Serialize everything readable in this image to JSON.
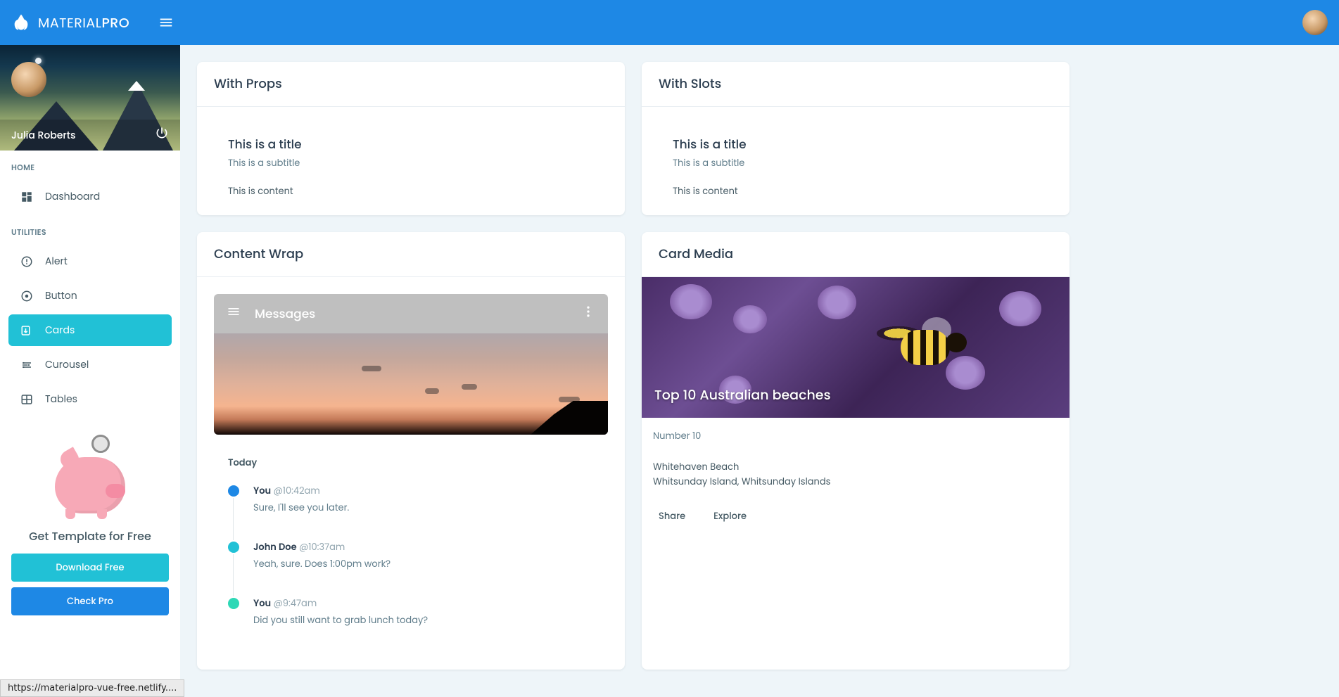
{
  "brand": {
    "main": "MATERIAL",
    "suffix": "PRO"
  },
  "profile": {
    "name": "Julia Roberts"
  },
  "nav": {
    "section1": "HOME",
    "items1": {
      "dashboard": "Dashboard"
    },
    "section2": "UTILITIES",
    "items2": {
      "alert": "Alert",
      "button": "Button",
      "cards": "Cards",
      "curousel": "Curousel",
      "tables": "Tables"
    }
  },
  "promo": {
    "title": "Get Template for Free",
    "download": "Download Free",
    "check": "Check Pro"
  },
  "cards": {
    "withProps": {
      "header": "With Props",
      "title": "This is a title",
      "subtitle": "This is a subtitle",
      "content": "This is content"
    },
    "withSlots": {
      "header": "With Slots",
      "title": "This is a title",
      "subtitle": "This is a subtitle",
      "content": "This is content"
    },
    "contentWrap": {
      "header": "Content Wrap",
      "mediaTitle": "Messages",
      "today": "Today",
      "timeline": [
        {
          "from": "You",
          "time": "@10:42am",
          "msg": "Sure, I'll see you later.",
          "color": "#1e88e5"
        },
        {
          "from": "John Doe",
          "time": "@10:37am",
          "msg": "Yeah, sure. Does 1:00pm work?",
          "color": "#21c1d6"
        },
        {
          "from": "You",
          "time": "@9:47am",
          "msg": "Did you still want to grab lunch today?",
          "color": "#2ed8b6"
        }
      ]
    },
    "cardMedia": {
      "header": "Card Media",
      "overlay": "Top 10 Australian beaches",
      "subtitle": "Number 10",
      "line1": "Whitehaven Beach",
      "line2": "Whitsunday Island, Whitsunday Islands",
      "share": "Share",
      "explore": "Explore"
    }
  },
  "statusbar": "https://materialpro-vue-free.netlify...."
}
